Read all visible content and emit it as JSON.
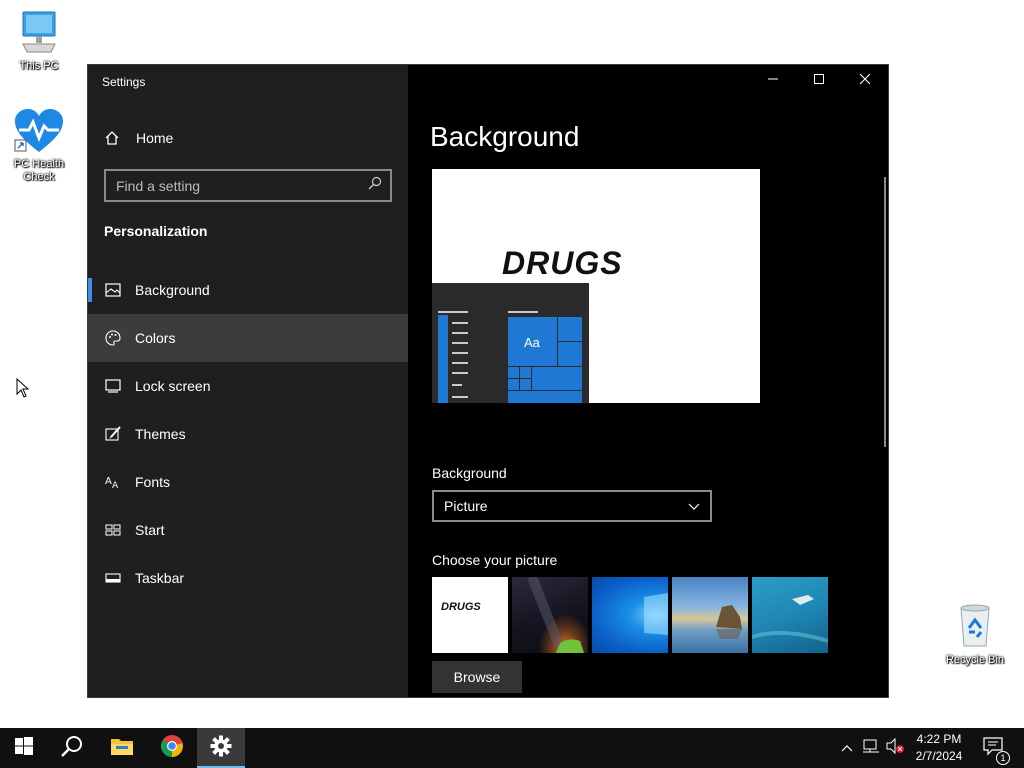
{
  "desktop": {
    "icons": [
      {
        "label": "This PC",
        "icon": "computer-icon"
      },
      {
        "label": "PC Health Check",
        "icon": "health-heart-icon"
      },
      {
        "label": "Recycle Bin",
        "icon": "recycle-bin-icon"
      }
    ]
  },
  "window": {
    "title": "Settings",
    "controls": {
      "minimize": "minimize-icon",
      "maximize": "maximize-icon",
      "close": "close-icon"
    }
  },
  "sidebar": {
    "home_label": "Home",
    "search_placeholder": "Find a setting",
    "section_title": "Personalization",
    "items": [
      {
        "label": "Background",
        "icon": "image-icon",
        "selected": true
      },
      {
        "label": "Colors",
        "icon": "palette-icon",
        "hover": true
      },
      {
        "label": "Lock screen",
        "icon": "lock-screen-icon"
      },
      {
        "label": "Themes",
        "icon": "themes-brush-icon"
      },
      {
        "label": "Fonts",
        "icon": "fonts-icon"
      },
      {
        "label": "Start",
        "icon": "start-layout-icon"
      },
      {
        "label": "Taskbar",
        "icon": "taskbar-icon"
      }
    ]
  },
  "main": {
    "title": "Background",
    "preview": {
      "wallpaper_text": "DRUGS",
      "tile_text": "Aa"
    },
    "background_label": "Background",
    "background_value": "Picture",
    "choose_label": "Choose your picture",
    "thumbnails": [
      {
        "name": "drugs-text-thumb",
        "text": "DRUGS"
      },
      {
        "name": "milky-way-thumb"
      },
      {
        "name": "windows-blue-thumb"
      },
      {
        "name": "coast-rock-thumb"
      },
      {
        "name": "underwater-swimmer-thumb"
      }
    ],
    "browse_label": "Browse"
  },
  "taskbar": {
    "apps": [
      "start-icon",
      "search-icon",
      "file-explorer-icon",
      "chrome-icon",
      "settings-icon"
    ],
    "active_app": "settings-icon",
    "time": "4:22 PM",
    "date": "2/7/2024",
    "notification_count": "1"
  },
  "colors": {
    "accent": "#3d8ee6",
    "sidebar_bg": "#1f1f1f",
    "content_bg": "#000000",
    "tile_blue": "#1e78d4"
  }
}
